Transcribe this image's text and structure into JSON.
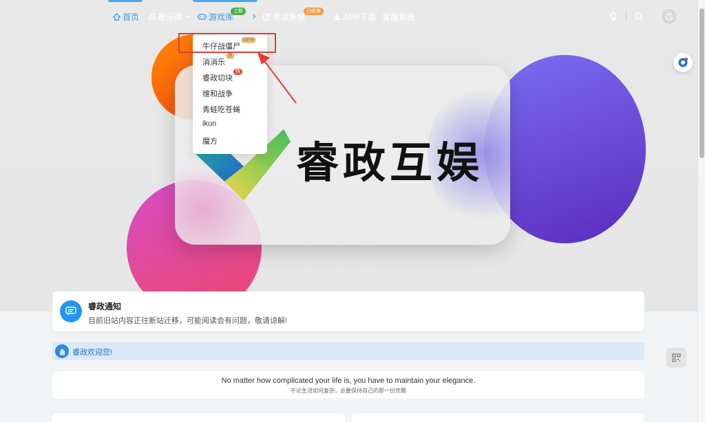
{
  "nav": {
    "items": [
      {
        "label": "首页",
        "icon": "home-icon"
      },
      {
        "label": "音乐库",
        "icon": "music-icon"
      },
      {
        "label": "游戏库",
        "icon": "gamepad-icon",
        "badge": "上新"
      },
      {
        "label": "考试系统",
        "icon": "edit-icon",
        "badge": "已结束"
      },
      {
        "label": "APP下载",
        "icon": "download-icon"
      },
      {
        "label": "客服系统"
      }
    ],
    "right_icons": [
      "lightbulb-icon",
      "search-icon",
      "moon-icon"
    ]
  },
  "games_dropdown": {
    "items": [
      {
        "label": "牛仔战僵尸",
        "badge": "NEW"
      },
      {
        "label": "消消乐",
        "badge": "热"
      },
      {
        "label": "睿政切块",
        "badge": "热"
      },
      {
        "label": "维和战争"
      },
      {
        "label": "青蛙吃苍蝇"
      },
      {
        "label": "ikun"
      },
      {
        "label": "魔方"
      }
    ]
  },
  "hero": {
    "brand": "睿政互娱"
  },
  "notice": {
    "title": "睿政通知",
    "text": "目前旧站内容正往新站迁移，可能阅读会有问题，敬请谅解!"
  },
  "welcome": {
    "text": "睿政欢迎您!"
  },
  "quote": {
    "en": "No matter how complicated your life is, you have to maintain your elegance.",
    "cn": "不论生活如何复杂，总要保持自己的那一份优雅"
  },
  "colors": {
    "accent": "#3d9de7",
    "badge_green": "#4caf50",
    "badge_orange": "#f39c3d",
    "badge_red": "#e8453c",
    "highlight": "#e53935"
  }
}
